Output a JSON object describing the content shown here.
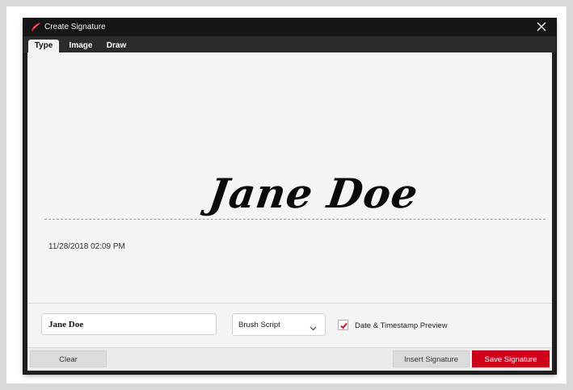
{
  "window": {
    "title": "Create Signature",
    "icons": {
      "app": "signature-pen-icon",
      "close": "close-icon"
    }
  },
  "tabs": [
    {
      "label": "Type",
      "active": true
    },
    {
      "label": "Image",
      "active": false
    },
    {
      "label": "Draw",
      "active": false
    }
  ],
  "preview": {
    "signature_text": "Jane Doe",
    "timestamp": "11/28/2018 02:09 PM"
  },
  "controls": {
    "name_value": "Jane Doe",
    "font_selected": "Brush Script",
    "date_timestamp_checked": true,
    "date_timestamp_label": "Date & Timestamp Preview"
  },
  "footer": {
    "clear_label": "Clear",
    "insert_label": "Insert Signature",
    "save_label": "Save Signature"
  },
  "colors": {
    "accent": "#d0021b",
    "titlebar": "#161616",
    "tabbar": "#2b2b2b"
  }
}
